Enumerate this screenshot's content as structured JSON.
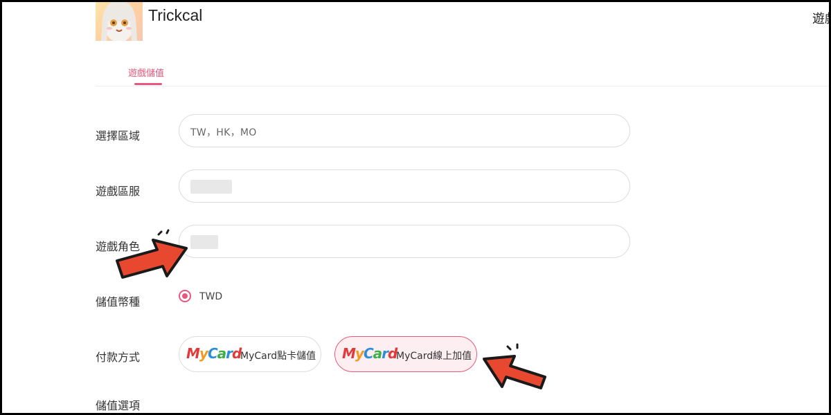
{
  "header": {
    "app_title": "Trickcal",
    "right_cut_text": "遊戲"
  },
  "tabs": [
    {
      "label": "遊戲儲值",
      "active": true
    }
  ],
  "form": {
    "region_label": "選擇區域",
    "region_value": "TW，HK，MO",
    "server_label": "遊戲區服",
    "role_label": "遊戲角色",
    "currency_label": "儲值幣種",
    "currency_option": "TWD",
    "payment_label": "付款方式",
    "payment_options": [
      {
        "logo": "MyCard",
        "label": "MyCard點卡儲值",
        "selected": false
      },
      {
        "logo": "MyCard",
        "label": "MyCard線上加值",
        "selected": true
      }
    ],
    "topup_label": "儲值選項"
  },
  "colors": {
    "accent": "#e8577d",
    "arrow": "#e8482f"
  }
}
